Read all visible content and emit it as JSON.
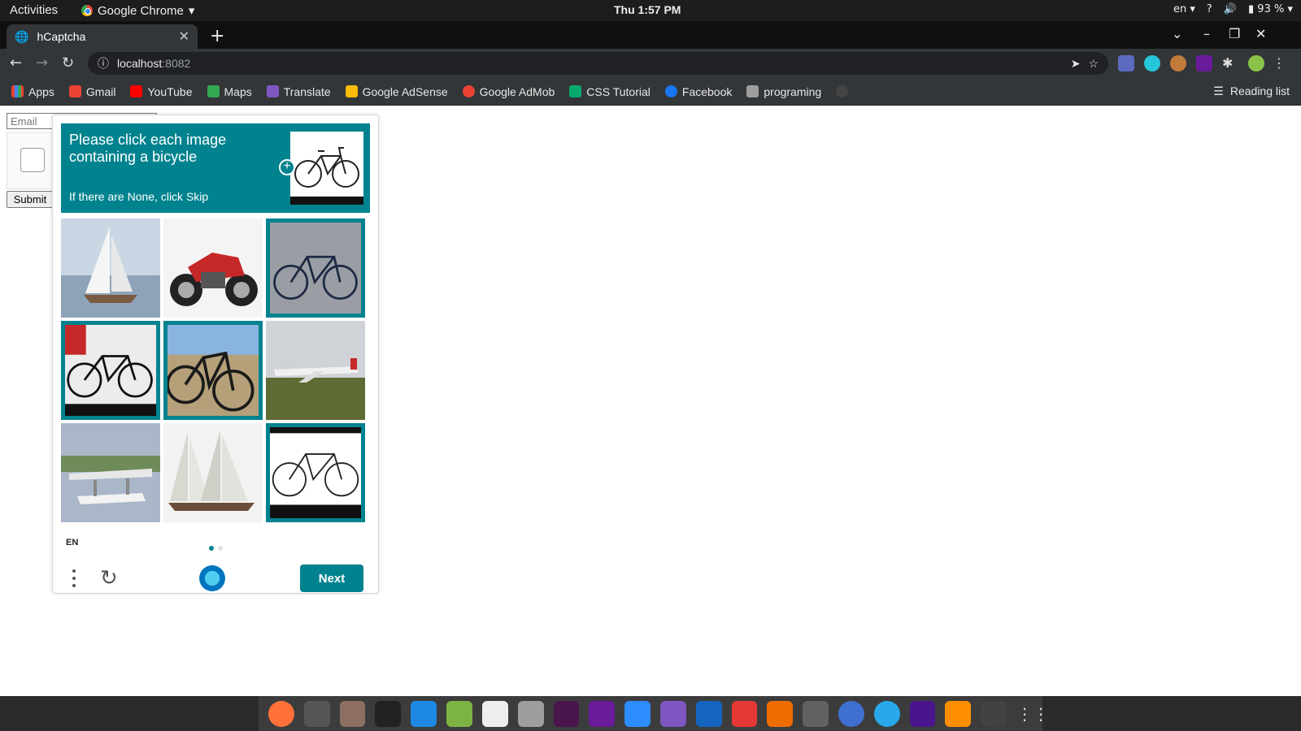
{
  "os": {
    "activities": "Activities",
    "app_menu": "Google Chrome",
    "clock": "Thu  1:57 PM",
    "keyboard": "en",
    "battery": "93 %"
  },
  "browser": {
    "tab_title": "hCaptcha",
    "url_host": "localhost",
    "url_port": ":8082",
    "bookmarks": [
      "Apps",
      "Gmail",
      "YouTube",
      "Maps",
      "Translate",
      "Google AdSense",
      "Google AdMob",
      "CSS Tutorial",
      "Facebook",
      "programing"
    ],
    "reading_list": "Reading list"
  },
  "form": {
    "email_placeholder": "Email",
    "submit_label": "Submit"
  },
  "challenge": {
    "prompt": "Please click each image containing a bicycle",
    "sub": "If there are None, click Skip",
    "language": "EN",
    "next_label": "Next",
    "accent": "#00838f",
    "tiles": [
      {
        "subject": "sailboat",
        "selected": false
      },
      {
        "subject": "motorcycle",
        "selected": false
      },
      {
        "subject": "bicycle",
        "selected": true
      },
      {
        "subject": "bicycle",
        "selected": true
      },
      {
        "subject": "bicycle",
        "selected": true
      },
      {
        "subject": "airplane",
        "selected": false
      },
      {
        "subject": "seaplane",
        "selected": false
      },
      {
        "subject": "sailing ship",
        "selected": false
      },
      {
        "subject": "bicycle",
        "selected": true
      }
    ]
  }
}
